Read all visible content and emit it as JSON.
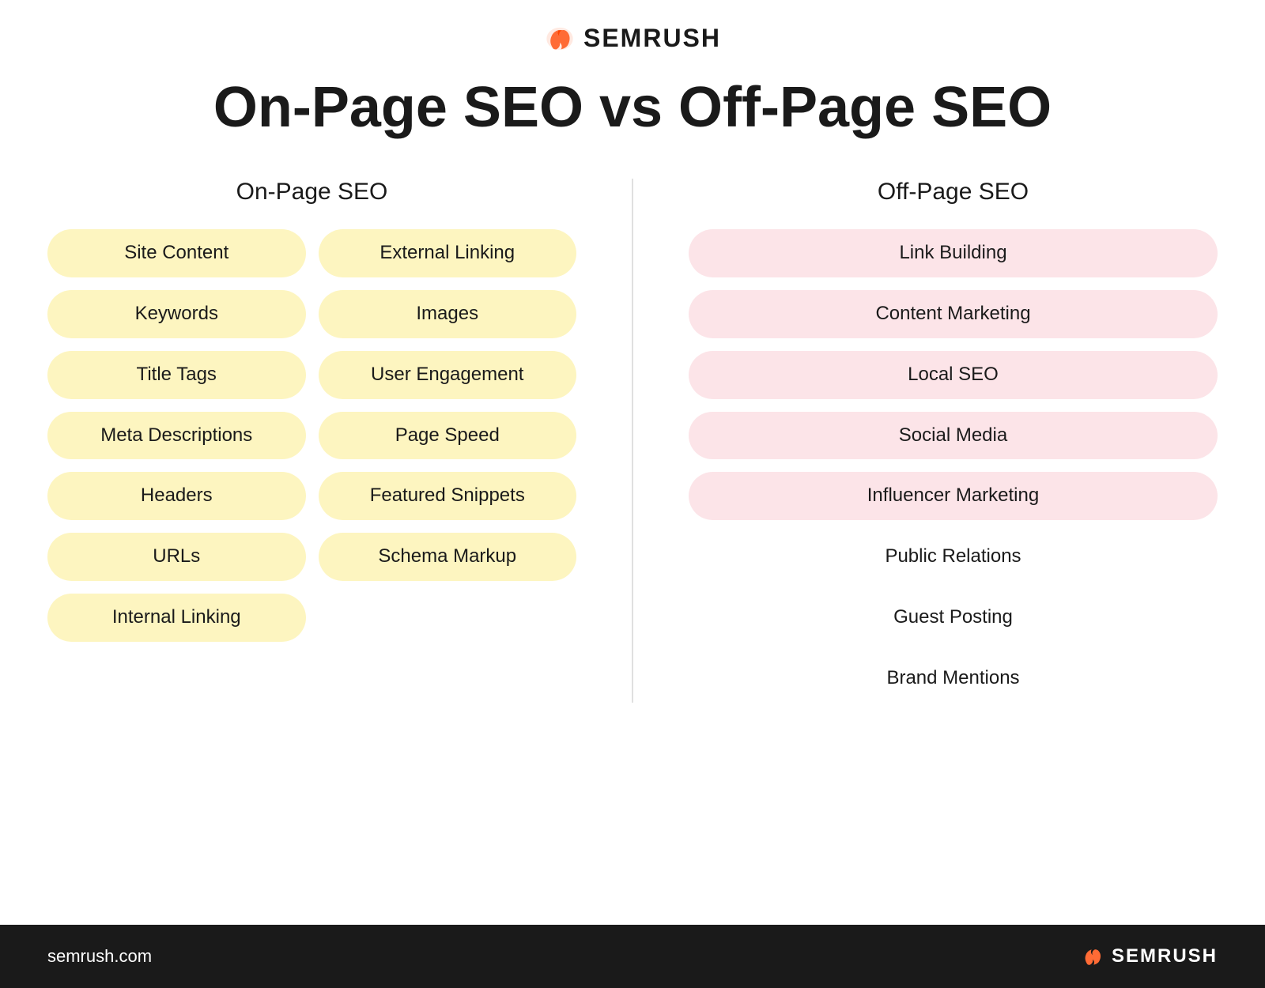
{
  "logo": {
    "text": "SEMRUSH",
    "url": "semrush.com"
  },
  "title": "On-Page SEO vs Off-Page SEO",
  "onpage": {
    "column_title": "On-Page SEO",
    "col1": [
      "Site Content",
      "Keywords",
      "Title Tags",
      "Meta Descriptions",
      "Headers",
      "URLs",
      "Internal Linking"
    ],
    "col2": [
      "External Linking",
      "Images",
      "User Engagement",
      "Page Speed",
      "Featured Snippets",
      "Schema Markup"
    ]
  },
  "offpage": {
    "column_title": "Off-Page SEO",
    "items": [
      "Link Building",
      "Content Marketing",
      "Local SEO",
      "Social Media",
      "Influencer Marketing",
      "Public Relations",
      "Guest Posting",
      "Brand Mentions"
    ]
  }
}
